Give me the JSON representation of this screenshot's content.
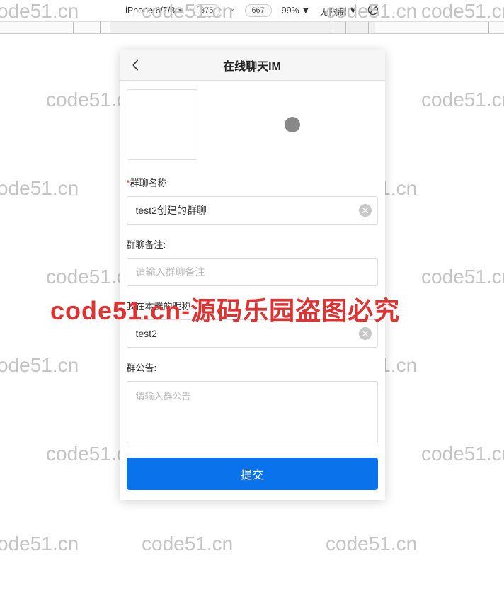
{
  "devtools": {
    "device": "iPhone 6/7/8",
    "width": "375",
    "height": "667",
    "zoom": "99%",
    "throttle": "无限制"
  },
  "app": {
    "title": "在线聊天IM"
  },
  "form": {
    "group_name_label": "群聊名称:",
    "group_name_value": "test2创建的群聊",
    "remark_label": "群聊备注:",
    "remark_placeholder": "请输入群聊备注",
    "nickname_label": "我在本群的昵称:",
    "nickname_value": "test2",
    "announce_label": "群公告:",
    "announce_placeholder": "请输入群公告",
    "submit": "提交"
  },
  "watermark": {
    "text": "code51.cn",
    "big": "code51.cn-源码乐园盗图必究"
  }
}
